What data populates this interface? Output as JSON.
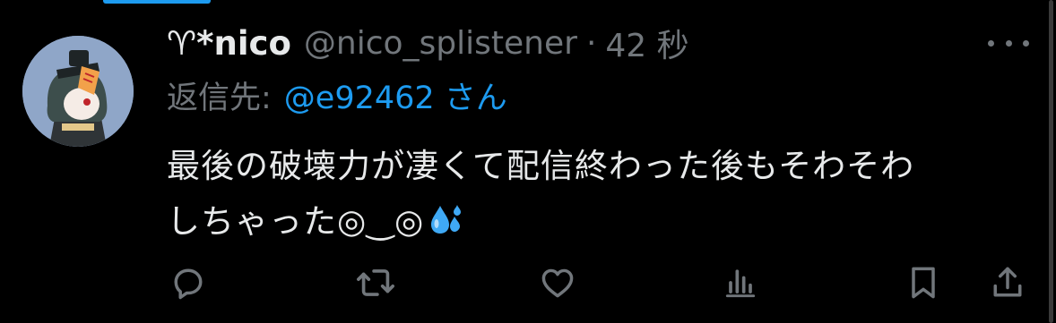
{
  "colors": {
    "background": "#000000",
    "primary_text": "#e7e9ea",
    "secondary_text": "#71767b",
    "accent": "#1d9bf0",
    "avatar_bg": "#8fa6c8"
  },
  "tweet": {
    "display_name": "♈*nico",
    "handle": "@nico_splistener",
    "separator": "·",
    "time": "42 秒",
    "reply_prefix": "返信先:",
    "reply_mention": "@e92462 さん",
    "text_line1": "最後の破壊力が凄くて配信終わった後もそわそわ",
    "text_line2": "しちゃった◎‿◎"
  },
  "icons": {
    "more": "more-icon",
    "reply": "reply-icon",
    "retweet": "retweet-icon",
    "like": "heart-icon",
    "views": "views-icon",
    "bookmark": "bookmark-icon",
    "share": "share-icon",
    "emoji": "sweat-droplets-emoji"
  }
}
